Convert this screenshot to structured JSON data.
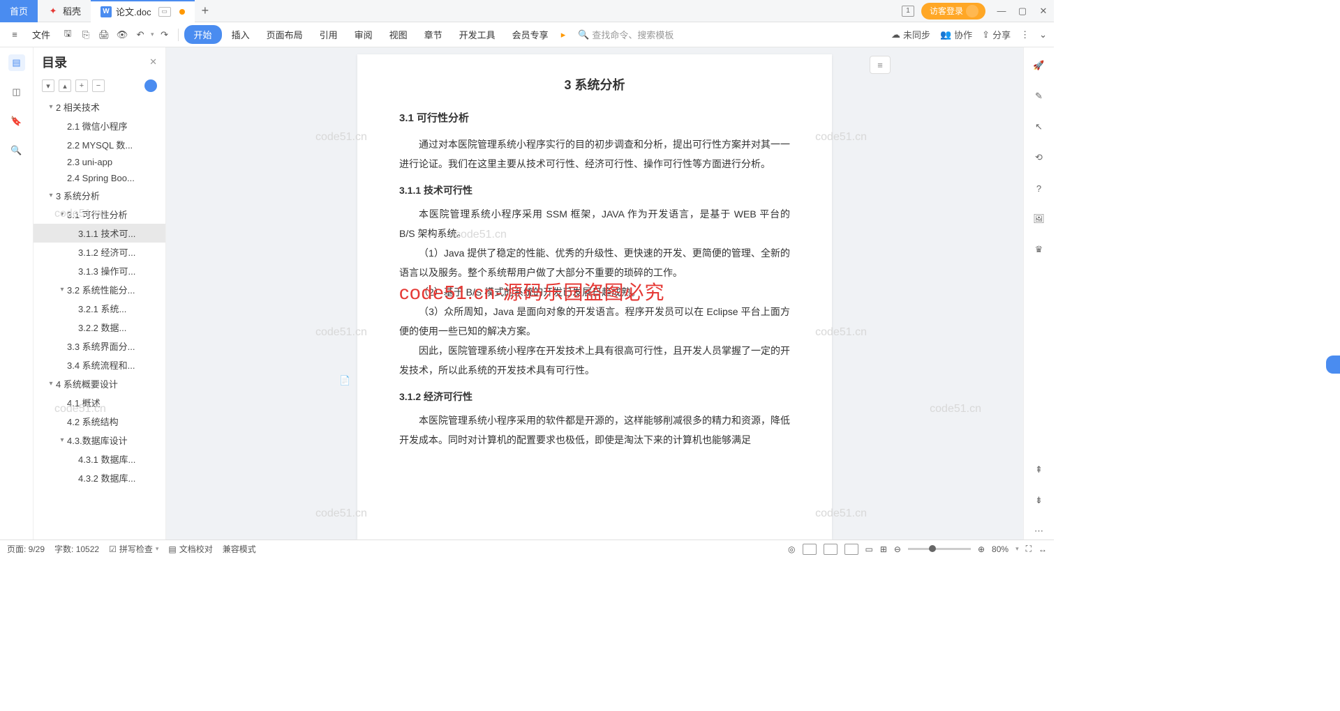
{
  "titlebar": {
    "home": "首页",
    "shell": "稻壳",
    "doc": "论文.doc",
    "badge1": "1",
    "login": "访客登录"
  },
  "toolbar": {
    "file": "文件",
    "menus": [
      "开始",
      "插入",
      "页面布局",
      "引用",
      "审阅",
      "视图",
      "章节",
      "开发工具",
      "会员专享"
    ],
    "search_placeholder": "查找命令、搜索模板",
    "sync": "未同步",
    "collab": "协作",
    "share": "分享"
  },
  "outline": {
    "title": "目录",
    "items": [
      {
        "level": 0,
        "chev": "▾",
        "text": "2 相关技术"
      },
      {
        "level": 1,
        "chev": "",
        "text": "2.1 微信小程序"
      },
      {
        "level": 1,
        "chev": "",
        "text": "2.2 MYSQL 数..."
      },
      {
        "level": 1,
        "chev": "",
        "text": "2.3 uni-app"
      },
      {
        "level": 1,
        "chev": "",
        "text": "2.4 Spring Boo..."
      },
      {
        "level": 0,
        "chev": "▾",
        "text": "3 系统分析"
      },
      {
        "level": 1,
        "chev": "▾",
        "text": "3.1 可行性分析"
      },
      {
        "level": 2,
        "chev": "",
        "text": "3.1.1 技术可...",
        "selected": true
      },
      {
        "level": 2,
        "chev": "",
        "text": "3.1.2 经济可..."
      },
      {
        "level": 2,
        "chev": "",
        "text": "3.1.3 操作可..."
      },
      {
        "level": 1,
        "chev": "▾",
        "text": "3.2 系统性能分..."
      },
      {
        "level": 2,
        "chev": "",
        "text": "3.2.1 系统..."
      },
      {
        "level": 2,
        "chev": "",
        "text": "3.2.2 数据..."
      },
      {
        "level": 1,
        "chev": "",
        "text": "3.3 系统界面分..."
      },
      {
        "level": 1,
        "chev": "",
        "text": "3.4 系统流程和..."
      },
      {
        "level": 0,
        "chev": "▾",
        "text": "4 系统概要设计"
      },
      {
        "level": 1,
        "chev": "",
        "text": "4.1 概述"
      },
      {
        "level": 1,
        "chev": "",
        "text": "4.2 系统结构"
      },
      {
        "level": 1,
        "chev": "▾",
        "text": "4.3.数据库设计"
      },
      {
        "level": 2,
        "chev": "",
        "text": "4.3.1 数据库..."
      },
      {
        "level": 2,
        "chev": "",
        "text": "4.3.2 数据库..."
      }
    ]
  },
  "doc": {
    "h2": "3 系统分析",
    "h3_1": "3.1 可行性分析",
    "p1": "通过对本医院管理系统小程序实行的目的初步调查和分析，提出可行性方案并对其一一进行论证。我们在这里主要从技术可行性、经济可行性、操作可行性等方面进行分析。",
    "h4_1": "3.1.1 技术可行性",
    "p2": "本医院管理系统小程序采用 SSM 框架，JAVA 作为开发语言，是基于 WEB 平台的 B/S 架构系统。",
    "p3": "（1）Java 提供了稳定的性能、优秀的升级性、更快速的开发、更简便的管理、全新的语言以及服务。整个系统帮用户做了大部分不重要的琐碎的工作。",
    "p4": "（2）基于 B/S 模式的系统的开发已发展日趋成熟。",
    "p5": "（3）众所周知，Java 是面向对象的开发语言。程序开发员可以在 Eclipse 平台上面方便的使用一些已知的解决方案。",
    "p6": "因此，医院管理系统小程序在开发技术上具有很高可行性，且开发人员掌握了一定的开发技术，所以此系统的开发技术具有可行性。",
    "h4_2": "3.1.2 经济可行性",
    "p7": "本医院管理系统小程序采用的软件都是开源的，这样能够削减很多的精力和资源，降低开发成本。同时对计算机的配置要求也极低，即使是淘汰下来的计算机也能够满足",
    "stamp": "code51.cn-源码乐园盗图必究",
    "watermark": "code51.cn"
  },
  "status": {
    "page": "页面: 9/29",
    "words": "字数: 10522",
    "spell": "拼写检查",
    "proof": "文档校对",
    "compat": "兼容模式",
    "zoom": "80%"
  }
}
